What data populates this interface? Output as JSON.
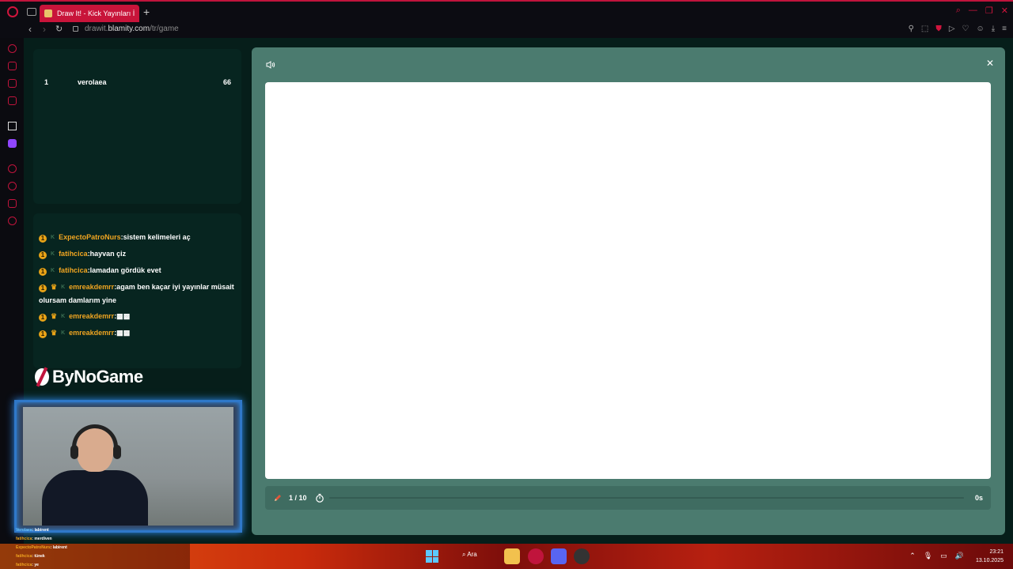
{
  "browser": {
    "tab_title": "Draw It! - Kick Yayınları İç",
    "url_prefix": "drawit.",
    "url_host": "blamity.com",
    "url_path": "/tr/game"
  },
  "leaderboard": {
    "rows": [
      {
        "rank": "1",
        "name": "verolaea",
        "score": "66"
      }
    ]
  },
  "chat": {
    "messages": [
      {
        "user": "ExpectoPatroNurs",
        "text": ":sistem kelimeleri aç",
        "crown": false
      },
      {
        "user": "fatihcica",
        "text": ":hayvan çiz",
        "crown": false
      },
      {
        "user": "fatihcica",
        "text": ":lamadan gördük evet",
        "crown": false
      },
      {
        "user": "emreakdemrr",
        "text": ":agam ben kaçar iyi yayınlar müsait olursam damlarım yine",
        "crown": true
      },
      {
        "user": "emreakdemrr",
        "text": ":▩▩",
        "crown": true
      },
      {
        "user": "emreakdemrr",
        "text": ":▩▩",
        "crown": true
      }
    ]
  },
  "brand": {
    "name": "ByNoGame"
  },
  "stream_chat": [
    {
      "user": "Verolaea",
      "text": ": labirent"
    },
    {
      "user": "fatihcica",
      "text": ": merdiven"
    },
    {
      "user": "ExpectoPatroNurs",
      "text": ": labirent"
    },
    {
      "user": "fatihcica",
      "text": ": tünek"
    },
    {
      "user": "fatihcica",
      "text": ": ye"
    }
  ],
  "game": {
    "round_label": "1 / 10",
    "seconds_label": "0s",
    "progress": 0
  },
  "taskbar": {
    "search_label": "Ara",
    "time": "23:21",
    "date": "13.10.2025"
  },
  "colors": {
    "accent": "#c8143a",
    "modal": "#4b7b6f",
    "panel": "#072520",
    "username": "#f0a521"
  }
}
